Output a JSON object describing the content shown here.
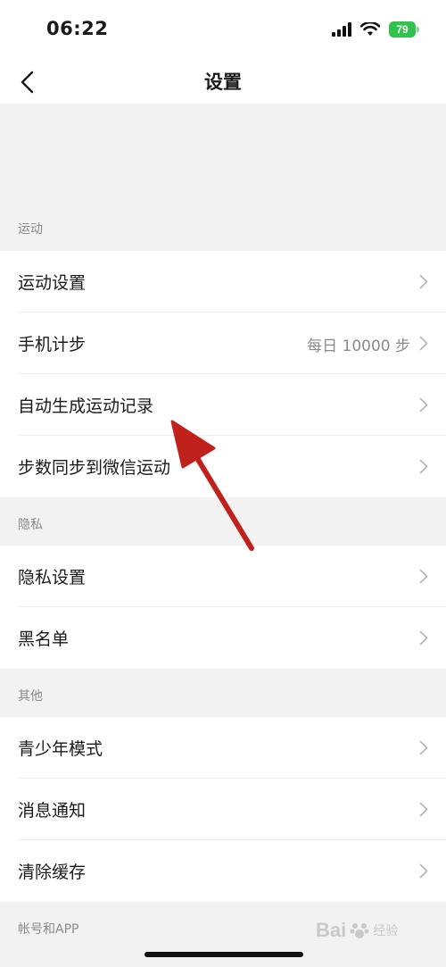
{
  "status_bar": {
    "time": "06:22",
    "battery": "79"
  },
  "nav": {
    "title": "设置",
    "back_icon": "chevron-left-icon"
  },
  "sections": {
    "sport": {
      "header": "运动",
      "items": [
        {
          "label": "运动设置",
          "value": ""
        },
        {
          "label": "手机计步",
          "value": "每日 10000 步"
        },
        {
          "label": "自动生成运动记录",
          "value": ""
        },
        {
          "label": "步数同步到微信运动",
          "value": ""
        }
      ]
    },
    "privacy": {
      "header": "隐私",
      "items": [
        {
          "label": "隐私设置"
        },
        {
          "label": "黑名单"
        }
      ]
    },
    "other": {
      "header": "其他",
      "items": [
        {
          "label": "青少年模式"
        },
        {
          "label": "消息通知"
        },
        {
          "label": "清除缓存"
        }
      ]
    },
    "account": {
      "header": "帐号和APP"
    }
  },
  "annotation": {
    "arrow_color": "#c0211d"
  },
  "watermark": {
    "brand": "Bai",
    "suffix": "经验"
  },
  "colors": {
    "background": "#f2f2f2",
    "card": "#ffffff",
    "secondary_text": "#8a8a8a"
  }
}
